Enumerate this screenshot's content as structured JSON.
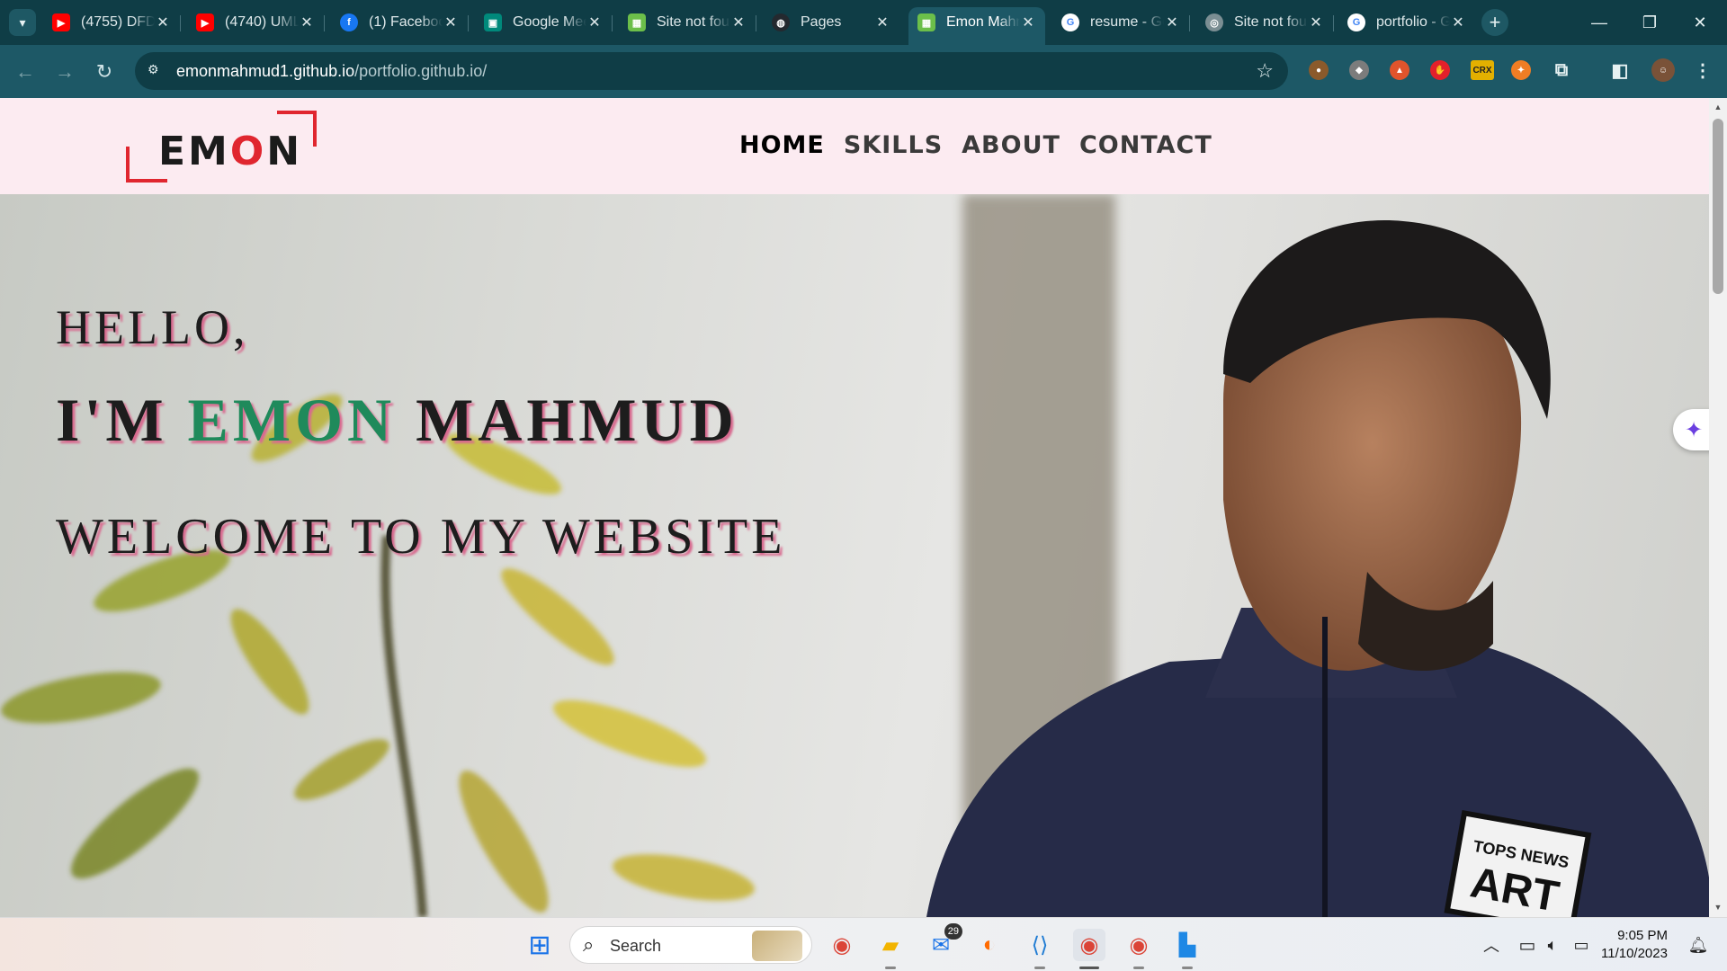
{
  "browser": {
    "tabs": [
      {
        "title": "(4755) DFD",
        "favicon": "youtube-icon",
        "color": "#ff0000",
        "active": false
      },
      {
        "title": "(4740) UML",
        "favicon": "youtube-icon",
        "color": "#ff0000",
        "active": false
      },
      {
        "title": "(1) Facebook",
        "favicon": "facebook-icon",
        "color": "#1877f2",
        "active": false
      },
      {
        "title": "Google Meet",
        "favicon": "google-meet-icon",
        "color": "#00897b",
        "active": false
      },
      {
        "title": "Site not found",
        "favicon": "site-icon",
        "color": "#6cbf4a",
        "active": false
      },
      {
        "title": "Pages",
        "favicon": "github-icon",
        "color": "#24292f",
        "active": false
      },
      {
        "title": "Emon Mahmud",
        "favicon": "site-icon",
        "color": "#6cbf4a",
        "active": true
      },
      {
        "title": "resume - Google",
        "favicon": "google-icon",
        "color": "#4285f4",
        "active": false
      },
      {
        "title": "Site not found",
        "favicon": "globe-icon",
        "color": "#7b8e93",
        "active": false
      },
      {
        "title": "portfolio - Google",
        "favicon": "google-icon",
        "color": "#4285f4",
        "active": false
      }
    ],
    "url_host": "emonmahmud1.github.io",
    "url_path": "/portfolio.github.io/"
  },
  "site": {
    "logo_text_before": "EM",
    "logo_text_o": "O",
    "logo_text_after": "N",
    "nav": [
      "HOME",
      "SKILLS",
      "ABOUT",
      "CONTACT"
    ],
    "hero": {
      "hello": "HELLO,",
      "im": "I'M ",
      "first_name": "EMON",
      "last_name": " MAHMUD",
      "welcome": "WELCOME TO MY WEBSITE"
    }
  },
  "taskbar": {
    "search_label": "Search",
    "mail_badge": "29",
    "time": "9:05 PM",
    "date": "11/10/2023"
  },
  "colors": {
    "accent_green": "#1f8a5b",
    "logo_red": "#e0262f",
    "header_bg": "#fcebf1",
    "chrome_dark": "#0f3d46"
  }
}
